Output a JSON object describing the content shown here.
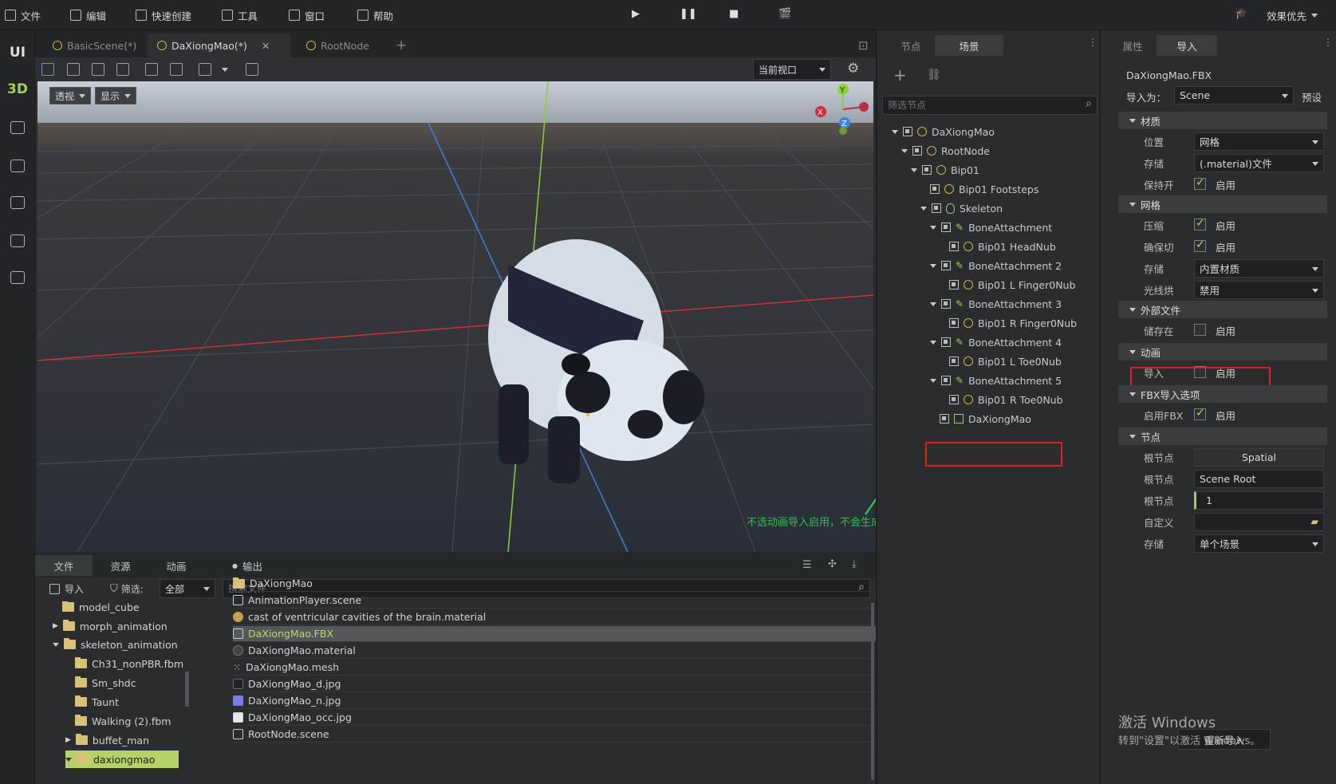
{
  "menu": {
    "file": "文件",
    "edit": "编辑",
    "quick_create": "快速创建",
    "tools": "工具",
    "window": "窗口",
    "help": "帮助",
    "quality": "效果优先"
  },
  "leftbar": {
    "ui": "UI",
    "3d": "3D"
  },
  "scene_tabs": [
    "BasicScene(*)",
    "DaXiongMao(*)",
    "RootNode"
  ],
  "viewport": {
    "view_mode": "当前视口",
    "perspective": "透视",
    "display": "显示"
  },
  "annotation": {
    "text": "不选动画导入启用，不会生成AnimationPlayer节点"
  },
  "bottom": {
    "tabs": [
      "文件",
      "资源",
      "动画",
      "输出"
    ],
    "import_label": "导入",
    "filter_label": "筛选:",
    "filter_value": "全部",
    "search_placeholder": "搜索文件",
    "folders": [
      "model_cube",
      "morph_animation",
      "skeleton_animation",
      "Ch31_nonPBR.fbm",
      "Sm_shdc",
      "Taunt",
      "Walking (2).fbm",
      "buffet_man",
      "daxiongmao"
    ],
    "files": [
      "DaXiongMao",
      "AnimationPlayer.scene",
      "cast of ventricular cavities of the brain.material",
      "DaXiongMao.FBX",
      "DaXiongMao.material",
      "DaXiongMao.mesh",
      "DaXiongMao_d.jpg",
      "DaXiongMao_n.jpg",
      "DaXiongMao_occ.jpg",
      "RootNode.scene"
    ]
  },
  "scene_panel": {
    "tabs": [
      "节点",
      "场景"
    ],
    "filter_placeholder": "筛选节点",
    "tree": [
      "DaXiongMao",
      "RootNode",
      "Bip01",
      "Bip01 Footsteps",
      "Skeleton",
      "BoneAttachment",
      "Bip01 HeadNub",
      "BoneAttachment 2",
      "Bip01 L Finger0Nub",
      "BoneAttachment 3",
      "Bip01 R Finger0Nub",
      "BoneAttachment 4",
      "Bip01 L Toe0Nub",
      "BoneAttachment 5",
      "Bip01 R Toe0Nub",
      "DaXiongMao"
    ]
  },
  "inspector": {
    "tabs": [
      "属性",
      "导入"
    ],
    "file_name": "DaXiongMao.FBX",
    "import_as_label": "导入为：",
    "import_as_value": "Scene",
    "preset": "预设",
    "sections": {
      "material": "材质",
      "mesh": "网格",
      "external": "外部文件",
      "animation": "动画",
      "fbx": "FBX导入选项",
      "nodes": "节点"
    },
    "enabled_label": "启用",
    "rows": {
      "location": "位置",
      "location_value": "网格",
      "storage": "存储",
      "storage_value": "(.material)文件",
      "keep_open": "保持开",
      "compress": "压缩",
      "ensure_tangent": "确保切",
      "mesh_storage": "存储",
      "mesh_storage_value": "内置材质",
      "lightmap": "光线烘",
      "lightmap_value": "禁用",
      "save_to": "储存在",
      "anim_import": "导入",
      "enable_fbx": "启用FBX",
      "root_type": "根节点",
      "root_type_value": "Spatial",
      "root_name": "根节点",
      "root_name_value": "Scene Root",
      "root_scale": "根节点",
      "root_scale_value": "1",
      "custom": "自定义",
      "node_storage": "存储",
      "node_storage_value": "单个场景"
    },
    "reimport": "重新导入"
  },
  "watermark": {
    "line1": "激活 Windows",
    "line2": "转到\"设置\"以激活 Windows。"
  }
}
